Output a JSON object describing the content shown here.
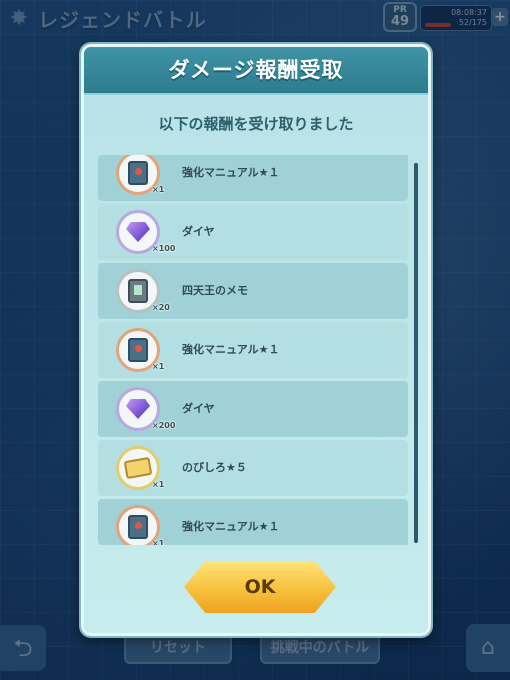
{
  "topbar": {
    "title": "レジェンドバトル",
    "pr_label": "PR",
    "pr_value": "49",
    "time": "08:08:37",
    "stamina": "52/175",
    "plus_label": "+"
  },
  "modal": {
    "title": "ダメージ報酬受取",
    "subtitle": "以下の報酬を受け取りました",
    "ok_label": "OK",
    "rewards": [
      {
        "name": "強化マニュアル★１",
        "qty": "×1",
        "icon": "training-manual-icon",
        "ring": "orange"
      },
      {
        "name": "ダイヤ",
        "qty": "×100",
        "icon": "gem-icon",
        "ring": "purple"
      },
      {
        "name": "四天王のメモ",
        "qty": "×20",
        "icon": "memo-icon",
        "ring": "gray"
      },
      {
        "name": "強化マニュアル★１",
        "qty": "×1",
        "icon": "training-manual-icon",
        "ring": "orange"
      },
      {
        "name": "ダイヤ",
        "qty": "×200",
        "icon": "gem-icon",
        "ring": "purple"
      },
      {
        "name": "のびしろ★５",
        "qty": "×1",
        "icon": "ticket-icon",
        "ring": "yellow"
      },
      {
        "name": "強化マニュアル★１",
        "qty": "×1",
        "icon": "training-manual-icon",
        "ring": "orange"
      }
    ]
  },
  "bottom": {
    "reset_label": "リセット",
    "battle_label": "挑戦中のバトル"
  },
  "colors": {
    "header": "#2d7b8e",
    "modal_bg": "#c7ecee",
    "ok_button": "#f7c13c"
  }
}
